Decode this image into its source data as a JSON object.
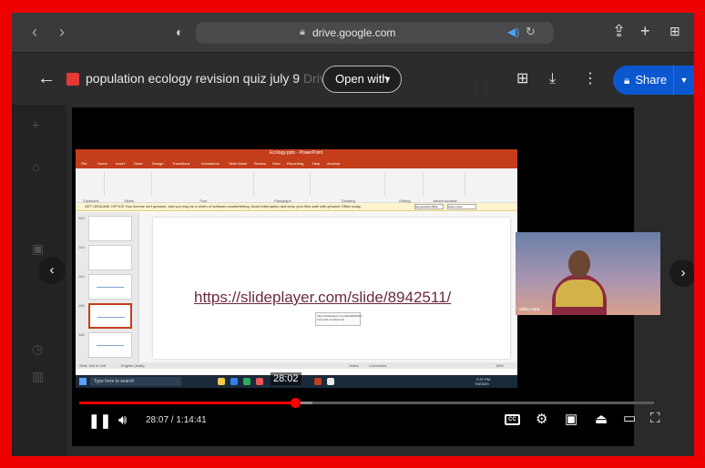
{
  "browser": {
    "url": "drive.google.com",
    "back_icon": "chevron-left-icon",
    "forward_icon": "chevron-right-icon",
    "share_icon": "share-icon",
    "new_tab_icon": "plus-icon",
    "tabs_icon": "tabs-grid-icon"
  },
  "drive": {
    "file_title": "population ecology revision quiz july 9",
    "file_tag": "Drive",
    "open_with_label": "Open with",
    "share_label": "Share",
    "brand_color": "#0b57d0"
  },
  "ppt": {
    "window_title": "Ecology.pptx - PowerPoint",
    "tabs": [
      "File",
      "Home",
      "Insert",
      "Draw",
      "Design",
      "Transitions",
      "Animations",
      "Slide Show",
      "Review",
      "View",
      "Recording",
      "Help",
      "Acrobat"
    ],
    "ribbon_groups": [
      "Clipboard",
      "Slides",
      "Font",
      "Paragraph",
      "Drawing",
      "Editing",
      "Adobe Acrobat"
    ],
    "warning": "GET GENUINE OFFICE  Your license isn't genuine, and you may be a victim of software counterfeiting. Avoid interruption and keep your files safe with genuine Office today.",
    "warning_btn1": "Get genuine Office",
    "warning_btn2": "Learn more",
    "thumb_numbers": [
      "162",
      "163",
      "164",
      "165",
      "166"
    ],
    "link_text": "https://slideplayer.com/slide/8942511/",
    "tooltip": "https://slideplayer.com/slide/8942511/ Ctrl+Click to follow link",
    "status_left": "Slide 165 of 188",
    "status_lang": "English (India)",
    "status_notes": "Notes",
    "status_comments": "Comments",
    "status_zoom": "68%",
    "taskbar_search": "Type here to search",
    "taskbar_time": "2:37 PM",
    "taskbar_date": "7/9/2023"
  },
  "cam": {
    "name": "sahu rupa"
  },
  "player": {
    "hover_time": "28:02",
    "current_time": "28:07",
    "duration": "1:14:41",
    "progress_fraction": 0.376,
    "buffered_fraction": 0.405,
    "cc_label": "CC"
  }
}
